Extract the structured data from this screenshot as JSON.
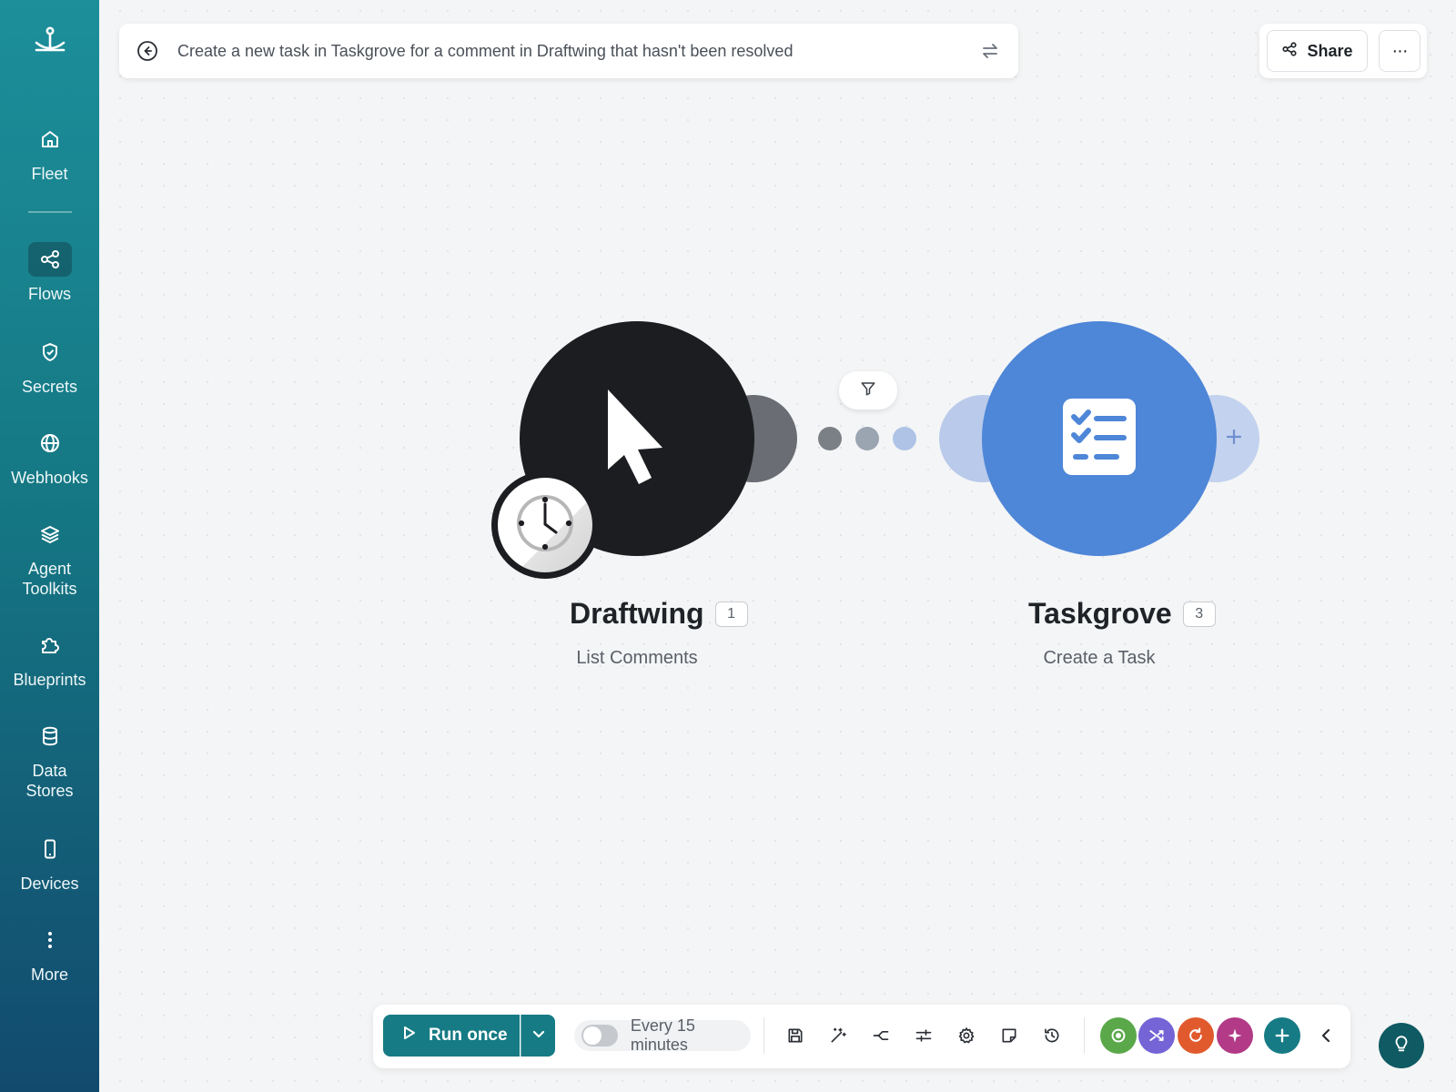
{
  "sidebar": {
    "items": [
      {
        "label": "Fleet",
        "icon": "home-icon"
      },
      {
        "label": "Flows",
        "icon": "share-nodes-icon"
      },
      {
        "label": "Secrets",
        "icon": "shield-icon"
      },
      {
        "label": "Webhooks",
        "icon": "globe-icon"
      },
      {
        "label": "Agent Toolkits",
        "icon": "layers-icon"
      },
      {
        "label": "Blueprints",
        "icon": "puzzle-icon"
      },
      {
        "label": "Data Stores",
        "icon": "database-icon"
      },
      {
        "label": "Devices",
        "icon": "phone-icon"
      },
      {
        "label": "More",
        "icon": "vertical-dots-icon"
      }
    ],
    "active": "Flows"
  },
  "header": {
    "prompt": "Create a new task in Taskgrove for a comment in Draftwing that hasn't been resolved",
    "share_label": "Share",
    "more_label": "···"
  },
  "modules": [
    {
      "name": "Draftwing",
      "number": "1",
      "action": "List Comments",
      "color": "#1c1d20"
    },
    {
      "name": "Taskgrove",
      "number": "3",
      "action": "Create a Task",
      "color": "#4e86d8"
    }
  ],
  "toolbar": {
    "run_label": "Run once",
    "schedule_label": "Every 15 minutes",
    "schedule_enabled": false,
    "accent": "#167b84"
  }
}
